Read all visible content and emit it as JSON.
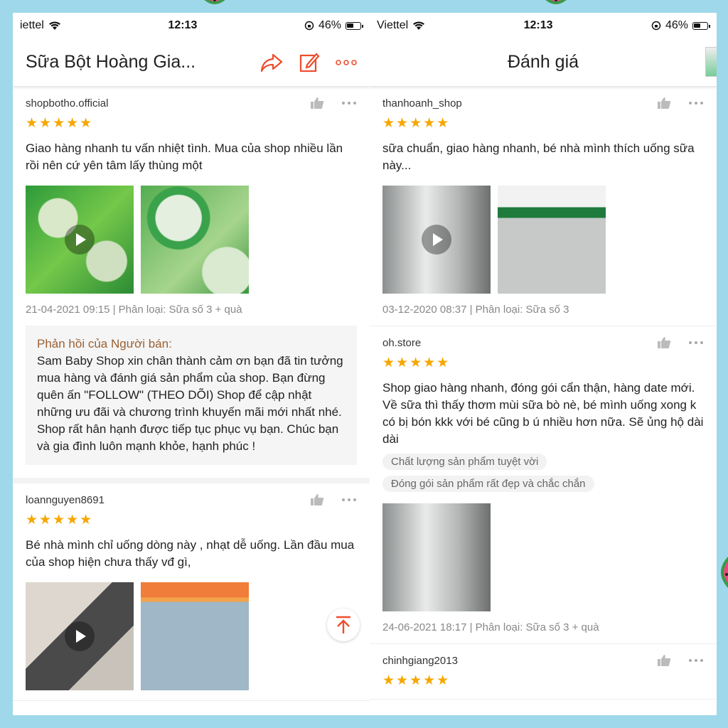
{
  "left": {
    "status": {
      "carrier": "iettel",
      "time": "12:13",
      "battery": "46%"
    },
    "nav": {
      "title": "Sữa Bột Hoàng Gia..."
    },
    "reviews": [
      {
        "username": "shopbotho.official",
        "stars": "★★★★★",
        "text": "Giao hàng nhanh tu vấn nhiệt tình. Mua của shop nhiều lần rồi nên cứ yên tâm lấy thùng một",
        "meta": "21-04-2021 09:15 | Phân loại: Sữa số 3 + quà",
        "reply_title": "Phản hồi của Người bán:",
        "reply_text": "Sam Baby Shop xin chân thành cảm ơn bạn đã tin tưởng mua hàng và đánh giá sản phẩm của shop. Bạn đừng quên ấn \"FOLLOW\" (THEO DÕI) Shop để cập nhật những ưu đãi và chương trình khuyến mãi mới nhất nhé. Shop rất hân hạnh được tiếp tục phục vụ bạn. Chúc bạn và gia đình luôn mạnh khỏe, hạnh phúc !"
      },
      {
        "username": "loannguyen8691",
        "stars": "★★★★★",
        "text": "Bé nhà mình chỉ uống dòng này , nhạt dễ uống. Lần đầu mua của shop hiện chưa thấy vđ gì,"
      }
    ]
  },
  "right": {
    "status": {
      "carrier": "Viettel",
      "time": "12:13",
      "battery": "46%"
    },
    "nav": {
      "title": "Đánh giá"
    },
    "reviews": [
      {
        "username": "thanhoanh_shop",
        "stars": "★★★★★",
        "text": "sữa chuẩn, giao hàng nhanh, bé nhà mình thích uống sữa này...",
        "meta": "03-12-2020 08:37 | Phân loại: Sữa số 3"
      },
      {
        "username": "oh.store",
        "stars": "★★★★★",
        "text": "Shop giao hàng nhanh, đóng gói cẩn thận, hàng date mới. Về sữa thì thấy thơm mùi sữa bò nè, bé mình uống xong k có bị bón kkk với bé cũng b ú nhiều hơn nữa. Sẽ ủng hộ dài dài",
        "tags": [
          "Chất lượng sản phẩm tuyệt vời",
          "Đóng gói sản phẩm rất đẹp và chắc chắn"
        ],
        "meta": "24-06-2021 18:17 | Phân loại: Sữa số 3 + quà"
      },
      {
        "username": "chinhgiang2013",
        "stars": "★★★★★"
      }
    ]
  },
  "colors": {
    "accent": "#ee4d2d",
    "star": "#f6a700",
    "reply_title": "#9a6033",
    "background": "#9fd8ea"
  }
}
